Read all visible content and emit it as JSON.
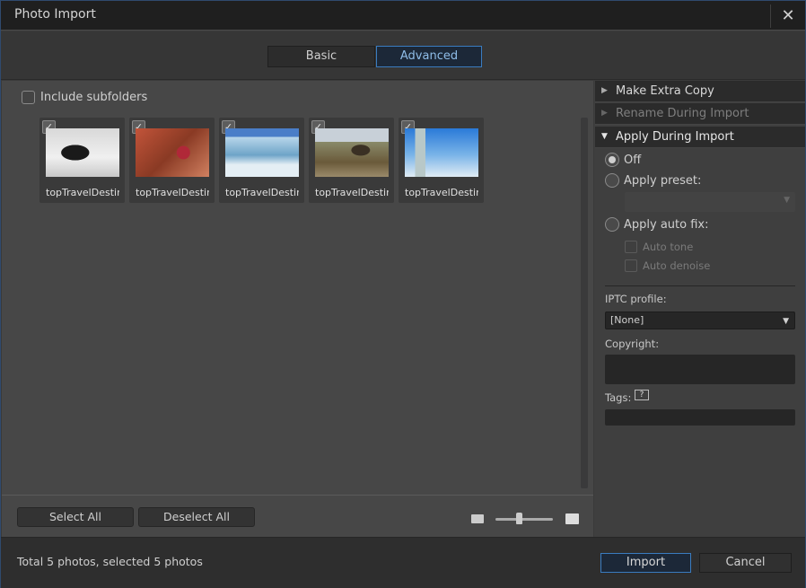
{
  "window": {
    "title": "Photo Import",
    "close_icon": "close-icon"
  },
  "modes": {
    "basic": "Basic",
    "advanced": "Advanced",
    "active": "Advanced"
  },
  "left": {
    "include_subfolders": {
      "label": "Include subfolders",
      "checked": false
    },
    "thumbnails": [
      {
        "caption": "topTravelDestina",
        "checked": true,
        "subject": "penguin"
      },
      {
        "caption": "topTravelDestina",
        "checked": true,
        "subject": "camel-rock"
      },
      {
        "caption": "topTravelDestina",
        "checked": true,
        "subject": "glacier"
      },
      {
        "caption": "topTravelDestina",
        "checked": true,
        "subject": "rocky-landscape"
      },
      {
        "caption": "topTravelDestina",
        "checked": true,
        "subject": "tower"
      }
    ],
    "select_all": "Select All",
    "deselect_all": "Deselect All",
    "thumbnail_size_slider": 0.4
  },
  "right": {
    "sections": [
      {
        "label": "Make Extra Copy",
        "expanded": false,
        "enabled": true
      },
      {
        "label": "Rename During Import",
        "expanded": false,
        "enabled": false
      },
      {
        "label": "Apply During Import",
        "expanded": true,
        "enabled": true
      }
    ],
    "apply": {
      "off": "Off",
      "apply_preset": "Apply preset:",
      "preset_value": "",
      "apply_auto_fix": "Apply auto fix:",
      "selected": "Off",
      "auto_tone": "Auto tone",
      "auto_denoise": "Auto denoise"
    },
    "iptc_label": "IPTC profile:",
    "iptc_value": "[None]",
    "copyright_label": "Copyright:",
    "copyright_value": "",
    "tags_label": "Tags:",
    "tags_icon_glyph": "?",
    "tags_value": ""
  },
  "footer": {
    "status": "Total 5 photos, selected 5 photos",
    "import": "Import",
    "cancel": "Cancel"
  },
  "colors": {
    "accent": "#3a7cc0",
    "accent_text": "#8fbde8"
  }
}
